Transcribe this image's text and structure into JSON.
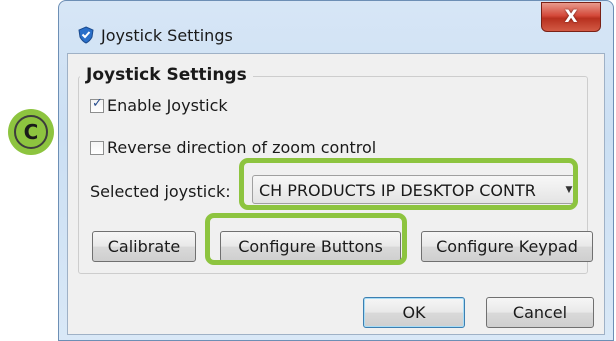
{
  "window": {
    "title": "Joystick Settings",
    "close_label": "X"
  },
  "group": {
    "title": "Joystick Settings"
  },
  "options": [
    {
      "label": "Enable Joystick",
      "checked": true
    },
    {
      "label": "Reverse direction of zoom control",
      "checked": false
    }
  ],
  "joystick": {
    "label": "Selected joystick:",
    "value": "CH PRODUCTS IP DESKTOP CONTR"
  },
  "buttons": {
    "calibrate": "Calibrate",
    "configure_buttons": "Configure Buttons",
    "configure_keypad": "Configure Keypad"
  },
  "footer": {
    "ok": "OK",
    "cancel": "Cancel"
  },
  "annotation": {
    "badge": "C",
    "highlight_color": "#8dc43f"
  }
}
